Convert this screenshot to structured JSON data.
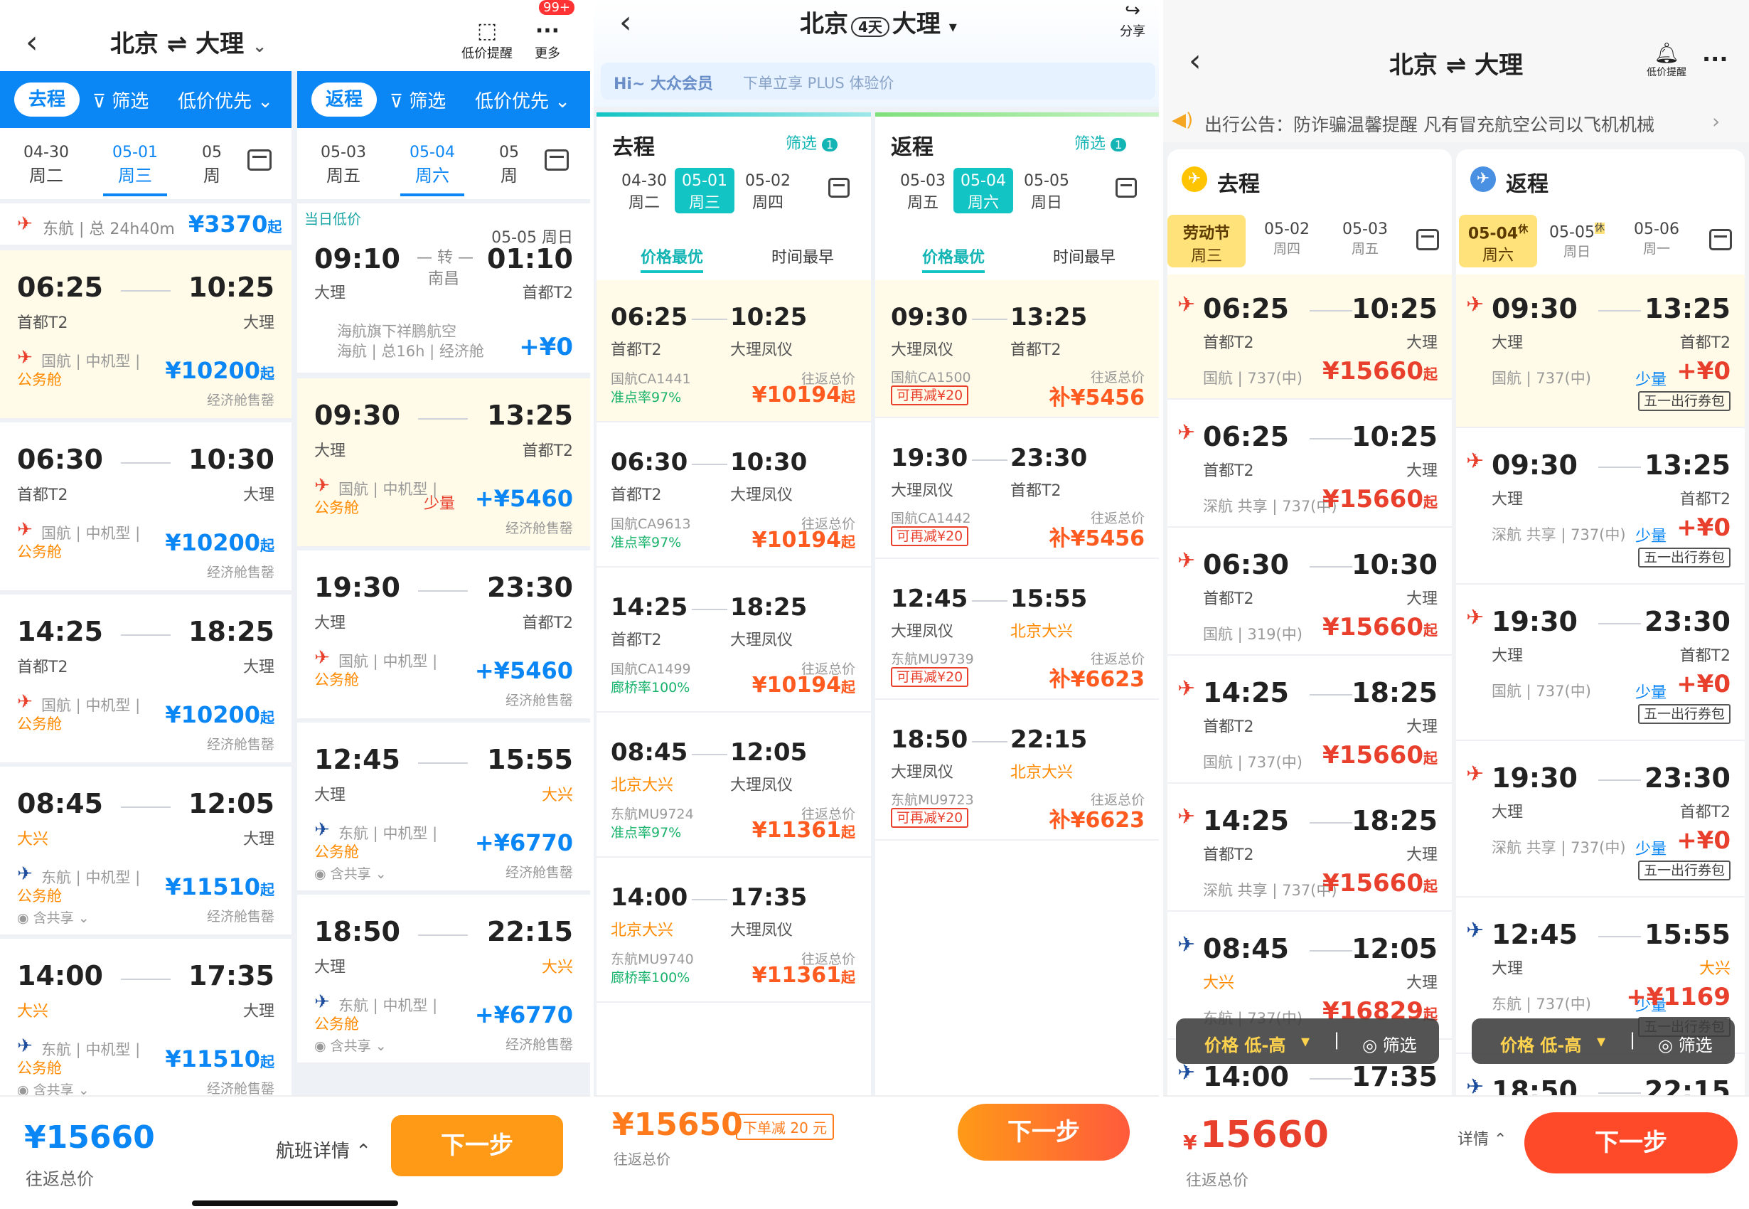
{
  "s1": {
    "title": "北京 ⇌ 大理",
    "nav_icons": {
      "alert": "低价提醒",
      "more": "更多",
      "badge": "99+"
    },
    "go_tab": {
      "label": "去程",
      "filter": "筛选",
      "sort": "低价优先"
    },
    "ret_tab": {
      "label": "返程",
      "filter": "筛选",
      "sort": "低价优先"
    },
    "go_dates": [
      {
        "d": "04-30",
        "w": "周二"
      },
      {
        "d": "05-01",
        "w": "周三"
      },
      {
        "d": "05",
        "w": "周"
      }
    ],
    "ret_dates": [
      {
        "d": "05-03",
        "w": "周五"
      },
      {
        "d": "05-04",
        "w": "周六"
      },
      {
        "d": "05",
        "w": "周"
      }
    ],
    "go_top": {
      "airline": "东航",
      "dur": "总 24h40m",
      "price": "¥3370",
      "qi": "起"
    },
    "go_flights": [
      {
        "dep": "06:25",
        "arr": "10:25",
        "from": "首都T2",
        "to": "大理",
        "airline": "国航",
        "type": "中机型",
        "cabin": "公务舱",
        "price": "¥10200",
        "qi": "起",
        "note": "经济舱售罄"
      },
      {
        "dep": "06:30",
        "arr": "10:30",
        "from": "首都T2",
        "to": "大理",
        "airline": "国航",
        "type": "中机型",
        "cabin": "公务舱",
        "price": "¥10200",
        "qi": "起",
        "note": "经济舱售罄"
      },
      {
        "dep": "14:25",
        "arr": "18:25",
        "from": "首都T2",
        "to": "大理",
        "airline": "国航",
        "type": "中机型",
        "cabin": "公务舱",
        "price": "¥10200",
        "qi": "起",
        "note": "经济舱售罄"
      },
      {
        "dep": "08:45",
        "arr": "12:05",
        "from": "大兴",
        "to": "大理",
        "airline": "东航",
        "type": "中机型",
        "cabin": "公务舱",
        "price": "¥11510",
        "qi": "起",
        "note": "经济舱售罄",
        "share": "含共享"
      },
      {
        "dep": "14:00",
        "arr": "17:35",
        "from": "大兴",
        "to": "大理",
        "airline": "东航",
        "type": "中机型",
        "cabin": "公务舱",
        "price": "¥11510",
        "qi": "起",
        "note": "经济舱售罄",
        "share": "含共享"
      }
    ],
    "ret_top": {
      "label": "当日低价",
      "date": "05-05 周日",
      "dep": "09:10",
      "arr": "01:10",
      "from": "大理",
      "to": "首都T2",
      "via": "转",
      "via_city": "南昌",
      "line1": "海航旗下祥鹏航空",
      "line2": "海航 | 总16h | 经济舱",
      "price": "+¥0"
    },
    "ret_flights": [
      {
        "dep": "09:30",
        "arr": "13:25",
        "from": "大理",
        "to": "首都T2",
        "airline": "国航",
        "type": "中机型",
        "cabin": "公务舱",
        "few": "少量",
        "price": "+¥5460",
        "note": "经济舱售罄"
      },
      {
        "dep": "19:30",
        "arr": "23:30",
        "from": "大理",
        "to": "首都T2",
        "airline": "国航",
        "type": "中机型",
        "cabin": "公务舱",
        "price": "+¥5460",
        "note": "经济舱售罄"
      },
      {
        "dep": "12:45",
        "arr": "15:55",
        "from": "大理",
        "to": "大兴",
        "airline": "东航",
        "type": "中机型",
        "cabin": "公务舱",
        "price": "+¥6770",
        "note": "经济舱售罄",
        "share": "含共享"
      },
      {
        "dep": "18:50",
        "arr": "22:15",
        "from": "大理",
        "to": "大兴",
        "airline": "东航",
        "type": "中机型",
        "cabin": "公务舱",
        "price": "+¥6770",
        "note": "经济舱售罄",
        "share": "含共享"
      }
    ],
    "bottom": {
      "price": "¥15660",
      "label": "往返总价",
      "detail": "航班详情",
      "next": "下一步"
    }
  },
  "s2": {
    "from": "北京",
    "days": "4天",
    "to": "大理",
    "share": "分享",
    "banner": {
      "brand": "Hi~ 大众会员",
      "text": "下单立享 PLUS 体验价"
    },
    "go": {
      "label": "去程",
      "filter": "筛选",
      "badge": "1",
      "sort1": "价格最优",
      "sort2": "时间最早",
      "dates": [
        {
          "d": "04-30",
          "w": "周二"
        },
        {
          "d": "05-01",
          "w": "周三"
        },
        {
          "d": "05-02",
          "w": "周四"
        }
      ],
      "flights": [
        {
          "dep": "06:25",
          "arr": "10:25",
          "from": "首都T2",
          "to": "大理凤仪",
          "no": "国航CA1441",
          "rate": "准点率97%",
          "lbl": "往返总价",
          "price": "¥10194",
          "qi": "起"
        },
        {
          "dep": "06:30",
          "arr": "10:30",
          "from": "首都T2",
          "to": "大理凤仪",
          "no": "国航CA9613",
          "rate": "准点率97%",
          "lbl": "往返总价",
          "price": "¥10194",
          "qi": "起"
        },
        {
          "dep": "14:25",
          "arr": "18:25",
          "from": "首都T2",
          "to": "大理凤仪",
          "no": "国航CA1499",
          "rate": "廊桥率100%",
          "lbl": "往返总价",
          "price": "¥10194",
          "qi": "起"
        },
        {
          "dep": "08:45",
          "arr": "12:05",
          "from": "北京大兴",
          "to": "大理凤仪",
          "no": "东航MU9724",
          "rate": "准点率97%",
          "lbl": "往返总价",
          "price": "¥11361",
          "qi": "起"
        },
        {
          "dep": "14:00",
          "arr": "17:35",
          "from": "北京大兴",
          "to": "大理凤仪",
          "no": "东航MU9740",
          "rate": "廊桥率100%",
          "lbl": "往返总价",
          "price": "¥11361",
          "qi": "起"
        }
      ]
    },
    "ret": {
      "label": "返程",
      "filter": "筛选",
      "badge": "1",
      "sort1": "价格最优",
      "sort2": "时间最早",
      "dates": [
        {
          "d": "05-03",
          "w": "周五"
        },
        {
          "d": "05-04",
          "w": "周六"
        },
        {
          "d": "05-05",
          "w": "周日"
        }
      ],
      "flights": [
        {
          "dep": "09:30",
          "arr": "13:25",
          "from": "大理凤仪",
          "to": "首都T2",
          "no": "国航CA1500",
          "tag": "可再减¥20",
          "lbl": "往返总价",
          "price": "补¥5456"
        },
        {
          "dep": "19:30",
          "arr": "23:30",
          "from": "大理凤仪",
          "to": "首都T2",
          "no": "国航CA1442",
          "tag": "可再减¥20",
          "lbl": "往返总价",
          "price": "补¥5456"
        },
        {
          "dep": "12:45",
          "arr": "15:55",
          "from": "大理凤仪",
          "to": "北京大兴",
          "no": "东航MU9739",
          "tag": "可再减¥20",
          "lbl": "往返总价",
          "price": "补¥6623"
        },
        {
          "dep": "18:50",
          "arr": "22:15",
          "from": "大理凤仪",
          "to": "北京大兴",
          "no": "东航MU9723",
          "tag": "可再减¥20",
          "lbl": "往返总价",
          "price": "补¥6623"
        }
      ]
    },
    "bottom": {
      "price": "¥15650",
      "tag": "下单减 20 元",
      "label": "往返总价",
      "next": "下一步"
    }
  },
  "s3": {
    "title": "北京 ⇌ 大理",
    "alert": "低价提醒",
    "notice": "出行公告：防诈骗温馨提醒  凡有冒充航空公司以飞机机械",
    "go": {
      "label": "去程",
      "dates": [
        {
          "d": "劳动节",
          "w": "周三"
        },
        {
          "d": "05-02",
          "w": "周四"
        },
        {
          "d": "05-03",
          "w": "周五"
        }
      ],
      "flights": [
        {
          "dep": "06:25",
          "arr": "10:25",
          "from": "首都T2",
          "to": "大理",
          "info": "国航 | 737(中)",
          "price": "¥15660",
          "qi": "起"
        },
        {
          "dep": "06:25",
          "arr": "10:25",
          "from": "首都T2",
          "to": "大理",
          "info": "深航 共享 | 737(中)",
          "price": "¥15660",
          "qi": "起"
        },
        {
          "dep": "06:30",
          "arr": "10:30",
          "from": "首都T2",
          "to": "大理",
          "info": "国航 | 319(中)",
          "price": "¥15660",
          "qi": "起"
        },
        {
          "dep": "14:25",
          "arr": "18:25",
          "from": "首都T2",
          "to": "大理",
          "info": "国航 | 737(中)",
          "price": "¥15660",
          "qi": "起"
        },
        {
          "dep": "14:25",
          "arr": "18:25",
          "from": "首都T2",
          "to": "大理",
          "info": "深航 共享 | 737(中)",
          "price": "¥15660",
          "qi": "起"
        },
        {
          "dep": "08:45",
          "arr": "12:05",
          "from": "大兴",
          "to": "大理",
          "info": "东航 | 737(中)",
          "price": "¥16829",
          "qi": "起"
        },
        {
          "dep": "14:00",
          "arr": "17:35",
          "from": "大兴",
          "to": "大理",
          "info": "",
          "price": "",
          "qi": ""
        }
      ]
    },
    "ret": {
      "label": "返程",
      "dates": [
        {
          "d": "05-04",
          "w": "周六",
          "rest": "休"
        },
        {
          "d": "05-05",
          "w": "周日",
          "rest": "休"
        },
        {
          "d": "05-06",
          "w": "周一"
        }
      ],
      "flights": [
        {
          "dep": "09:30",
          "arr": "13:25",
          "from": "大理",
          "to": "首都T2",
          "info": "国航 | 737(中)",
          "few": "少量",
          "price": "+¥0",
          "coupon": "五一出行券包"
        },
        {
          "dep": "09:30",
          "arr": "13:25",
          "from": "大理",
          "to": "首都T2",
          "info": "深航 共享 | 737(中)",
          "few": "少量",
          "price": "+¥0",
          "coupon": "五一出行券包"
        },
        {
          "dep": "19:30",
          "arr": "23:30",
          "from": "大理",
          "to": "首都T2",
          "info": "国航 | 737(中)",
          "few": "少量",
          "price": "+¥0",
          "coupon": "五一出行券包"
        },
        {
          "dep": "19:30",
          "arr": "23:30",
          "from": "大理",
          "to": "首都T2",
          "info": "深航 共享 | 737(中)",
          "few": "少量",
          "price": "+¥0",
          "coupon": "五一出行券包"
        },
        {
          "dep": "12:45",
          "arr": "15:55",
          "from": "大理",
          "to": "大兴",
          "info": "东航 | 737(中)",
          "few": "少量",
          "price": "+¥1169",
          "coupon": "五一出行券包"
        },
        {
          "dep": "18:50",
          "arr": "22:15",
          "from": "",
          "to": "",
          "info": "",
          "few": "",
          "price": "",
          "coupon": ""
        }
      ]
    },
    "sortbar": {
      "sort": "价格 低-高",
      "filter": "筛选"
    },
    "bottom": {
      "price": "15660",
      "currency": "¥",
      "label": "往返总价",
      "detail": "详情",
      "next": "下一步"
    }
  }
}
